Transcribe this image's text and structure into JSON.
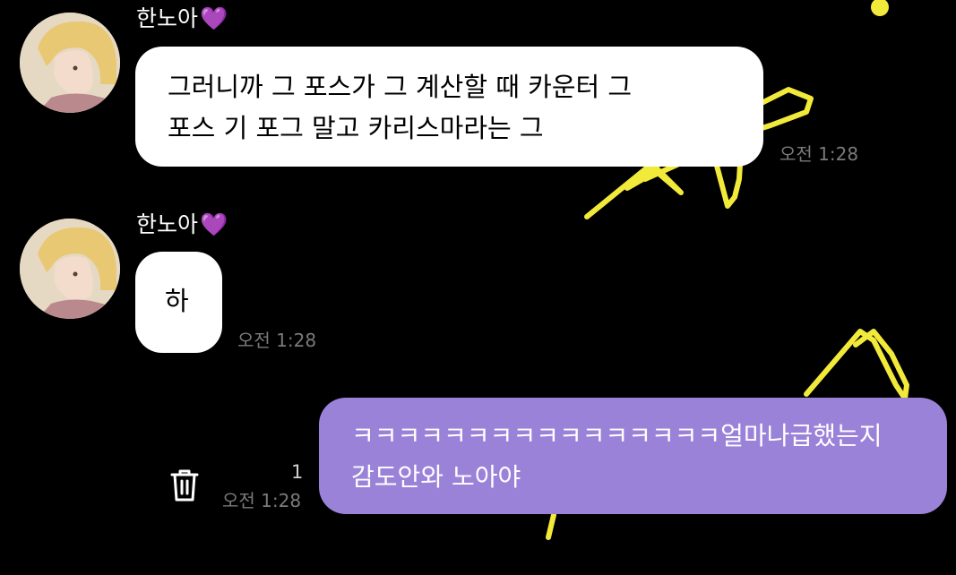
{
  "colors": {
    "background": "#000000",
    "incoming_bubble": "#ffffff",
    "outgoing_bubble": "#9b82d9",
    "timestamp": "#7a7a7a",
    "doodle": "#f2ea3a",
    "heart": "#9b5de5"
  },
  "messages": [
    {
      "direction": "incoming",
      "sender": "한노아",
      "sender_emoji": "💜",
      "lines": [
        "그러니까 그 포스가 그 계산할 때 카운터 그",
        "포스 기 포그 말고 카리스마라는 그"
      ],
      "time": "오전 1:28"
    },
    {
      "direction": "incoming",
      "sender": "한노아",
      "sender_emoji": "💜",
      "lines": [
        "하"
      ],
      "time": "오전 1:28"
    },
    {
      "direction": "outgoing",
      "lines": [
        "ㅋㅋㅋㅋㅋㅋㅋㅋㅋㅋㅋㅋㅋㅋㅋㅋ얼마나급했는지",
        "감도안와 노아야"
      ],
      "unread_count": "1",
      "time": "오전 1:28",
      "action_icon": "trash-icon"
    }
  ]
}
